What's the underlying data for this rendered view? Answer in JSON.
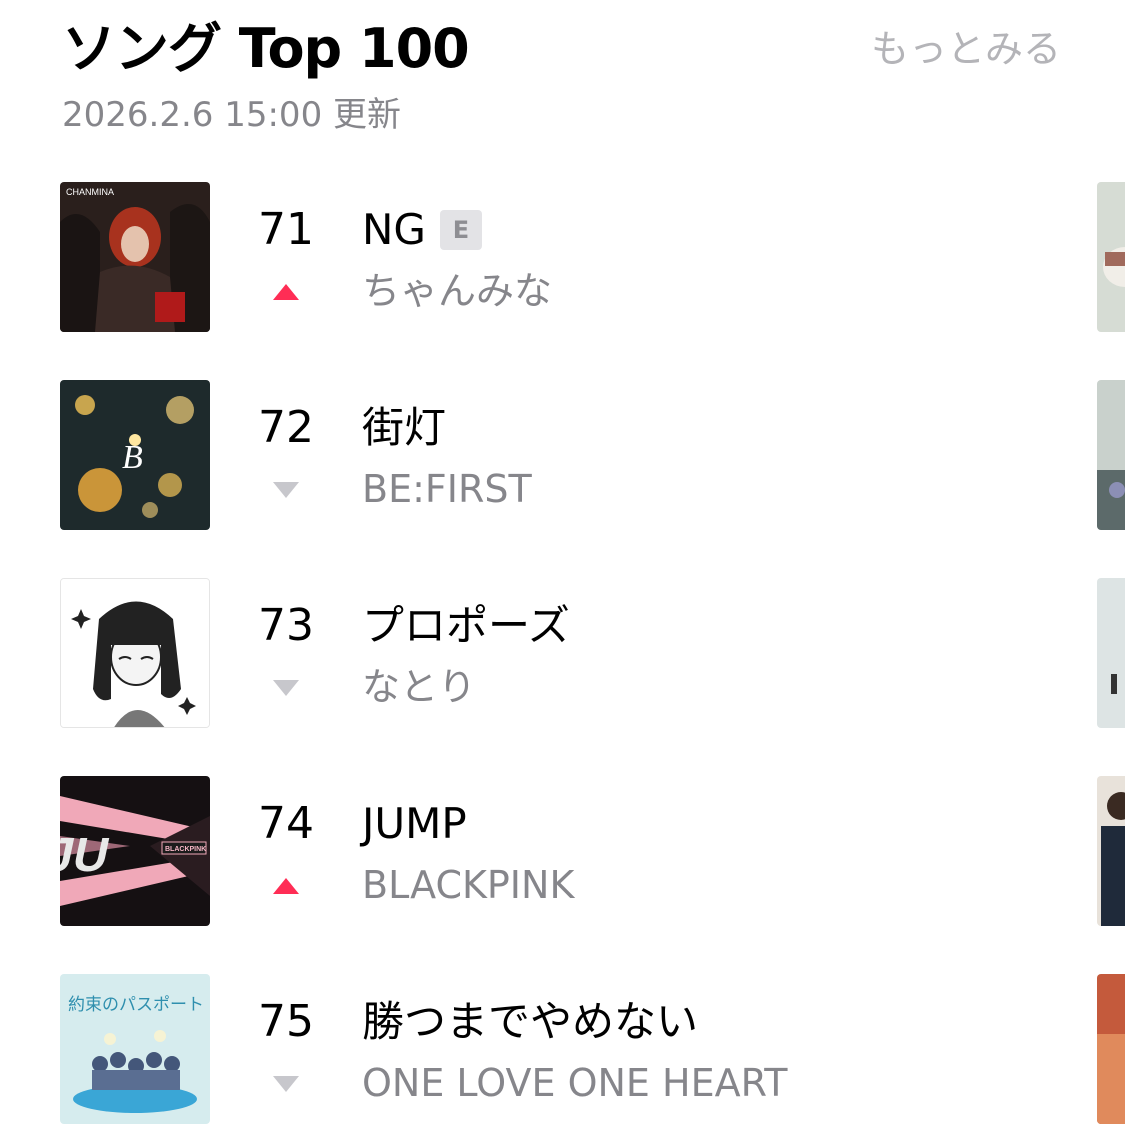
{
  "header": {
    "title": "ソング Top 100",
    "more_label": "もっとみる",
    "updated": "2026.2.6 15:00 更新"
  },
  "colors": {
    "trend_up": "#ff2d55",
    "trend_down": "#c7c7cc",
    "secondary_text": "#86868b"
  },
  "songs": [
    {
      "rank": "71",
      "title": "NG",
      "explicit": "E",
      "artist": "ちゃんみな",
      "trend": "up",
      "artwork_text": "CHANMINA"
    },
    {
      "rank": "72",
      "title": "街灯",
      "artist": "BE:FIRST",
      "trend": "down",
      "artwork_text": "B"
    },
    {
      "rank": "73",
      "title": "プロポーズ",
      "artist": "なとり",
      "trend": "down"
    },
    {
      "rank": "74",
      "title": "JUMP",
      "artist": "BLACKPINK",
      "trend": "up",
      "artwork_text": "BLACKPINK"
    },
    {
      "rank": "75",
      "title": "勝つまでやめない",
      "artist": "ONE LOVE ONE HEART",
      "trend": "down",
      "artwork_text": "約束のパスポート"
    }
  ]
}
